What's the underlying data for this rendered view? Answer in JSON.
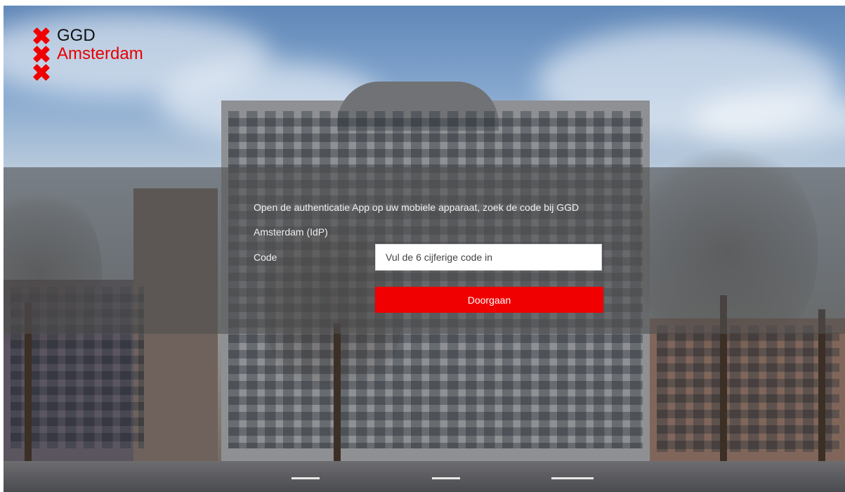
{
  "logo": {
    "lines": [
      "GGD",
      "Amsterdam",
      ""
    ]
  },
  "login": {
    "instruction": "Open de authenticatie App op uw mobiele apparaat, zoek de code bij GGD Amsterdam (IdP)",
    "code_label": "Code",
    "code_placeholder": "Vul de 6 cijferige code in",
    "submit_label": "Doorgaan"
  },
  "colors": {
    "accent": "#f00000",
    "overlay": "rgba(80,80,80,0.62)"
  }
}
